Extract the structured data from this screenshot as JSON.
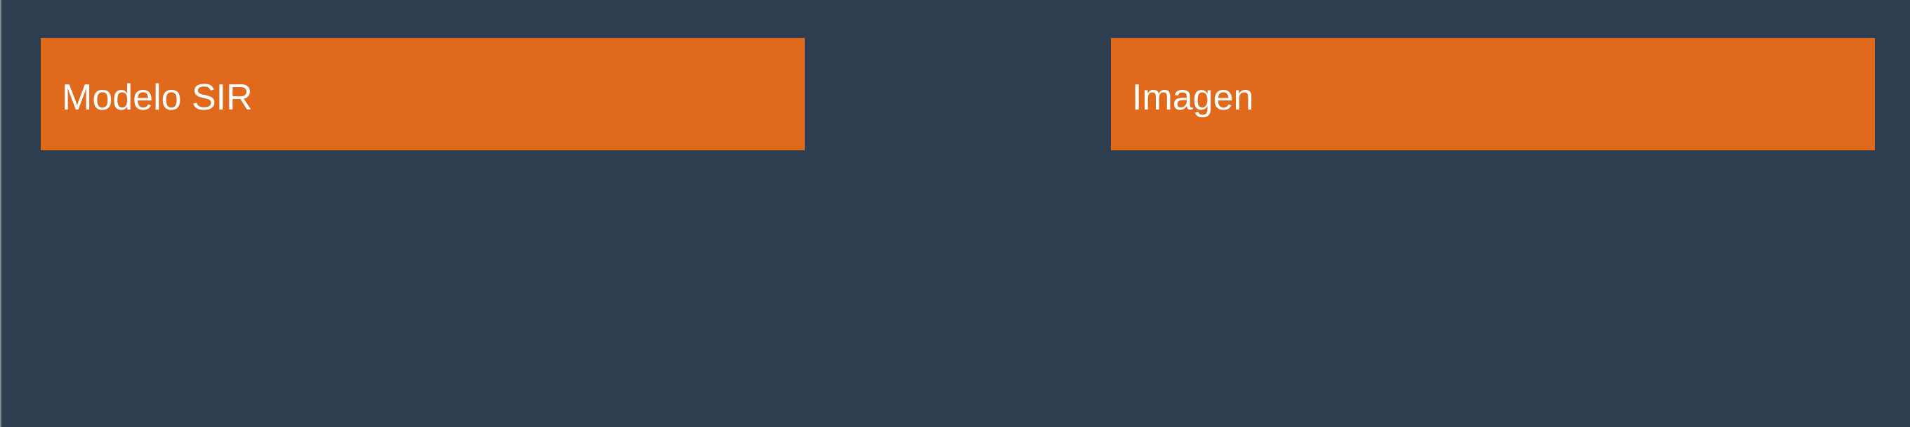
{
  "panels": [
    {
      "title": "Modelo SIR"
    },
    {
      "title": "Imagen"
    }
  ],
  "colors": {
    "background": "#2c3e50",
    "panel_header": "#e0691b",
    "title_text": "#ffffff"
  }
}
